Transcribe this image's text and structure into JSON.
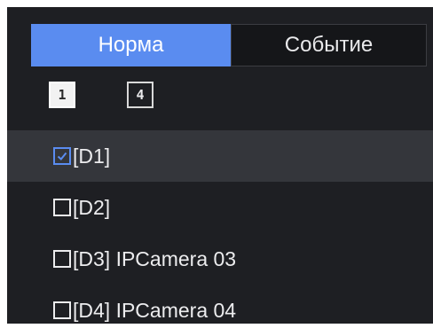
{
  "tabs": {
    "normal_label": "Норма",
    "event_label": "Событие",
    "active": "normal"
  },
  "layout_buttons": {
    "single_label": "1",
    "quad_label": "4",
    "active": "single"
  },
  "channels": [
    {
      "label": "[D1]",
      "checked": true
    },
    {
      "label": "[D2]",
      "checked": false
    },
    {
      "label": "[D3] IPCamera 03",
      "checked": false
    },
    {
      "label": "[D4] IPCamera 04",
      "checked": false
    }
  ],
  "colors": {
    "accent": "#5a8cf0",
    "panel_bg": "#1e1f23",
    "selected_row_bg": "#34363b",
    "text": "#ececee"
  },
  "icons": {
    "checkbox_checked": "checkbox-checked-icon",
    "checkbox_unchecked": "checkbox-unchecked-icon"
  }
}
